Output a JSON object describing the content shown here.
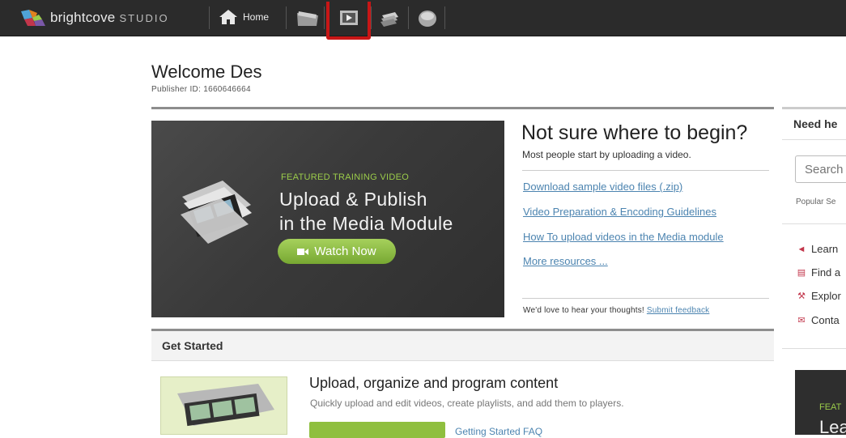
{
  "header": {
    "brand": "brightcove",
    "product": "STUDIO",
    "home_label": "Home",
    "nav_icons": [
      "folder-icon",
      "media-icon",
      "stack-icon",
      "disc-icon"
    ]
  },
  "welcome": {
    "title": "Welcome Des",
    "publisher_id": "Publisher ID: 1660646664"
  },
  "hero": {
    "kicker": "FEATURED TRAINING VIDEO",
    "title_line1": "Upload & Publish",
    "title_line2": "in the Media Module",
    "button": "Watch Now"
  },
  "begin": {
    "title": "Not sure where to begin?",
    "subtitle": "Most people start by uploading a video.",
    "links": [
      "Download sample video files (.zip)",
      "Video Preparation & Encoding Guidelines",
      "How To upload videos in the Media module",
      "More resources ..."
    ],
    "feedback_text": "We'd love to hear your thoughts!",
    "feedback_link": "Submit feedback"
  },
  "get_started": {
    "heading": "Get Started",
    "item_title": "Upload, organize and program content",
    "item_sub": "Quickly upload and edit videos, create playlists, and add them to players.",
    "faq": "Getting Started FAQ"
  },
  "sidebar": {
    "heading": "Need he",
    "search_placeholder": "Search",
    "popular": "Popular Se",
    "items": [
      "Learn",
      "Find a",
      "Explor",
      "Conta"
    ],
    "promo_kicker": "FEAT",
    "promo_title": "Lea"
  },
  "colors": {
    "accent_green": "#8fbf3f",
    "link_blue": "#4c84b0",
    "topbar": "#2b2b2b",
    "active_highlight": "#c81616"
  }
}
